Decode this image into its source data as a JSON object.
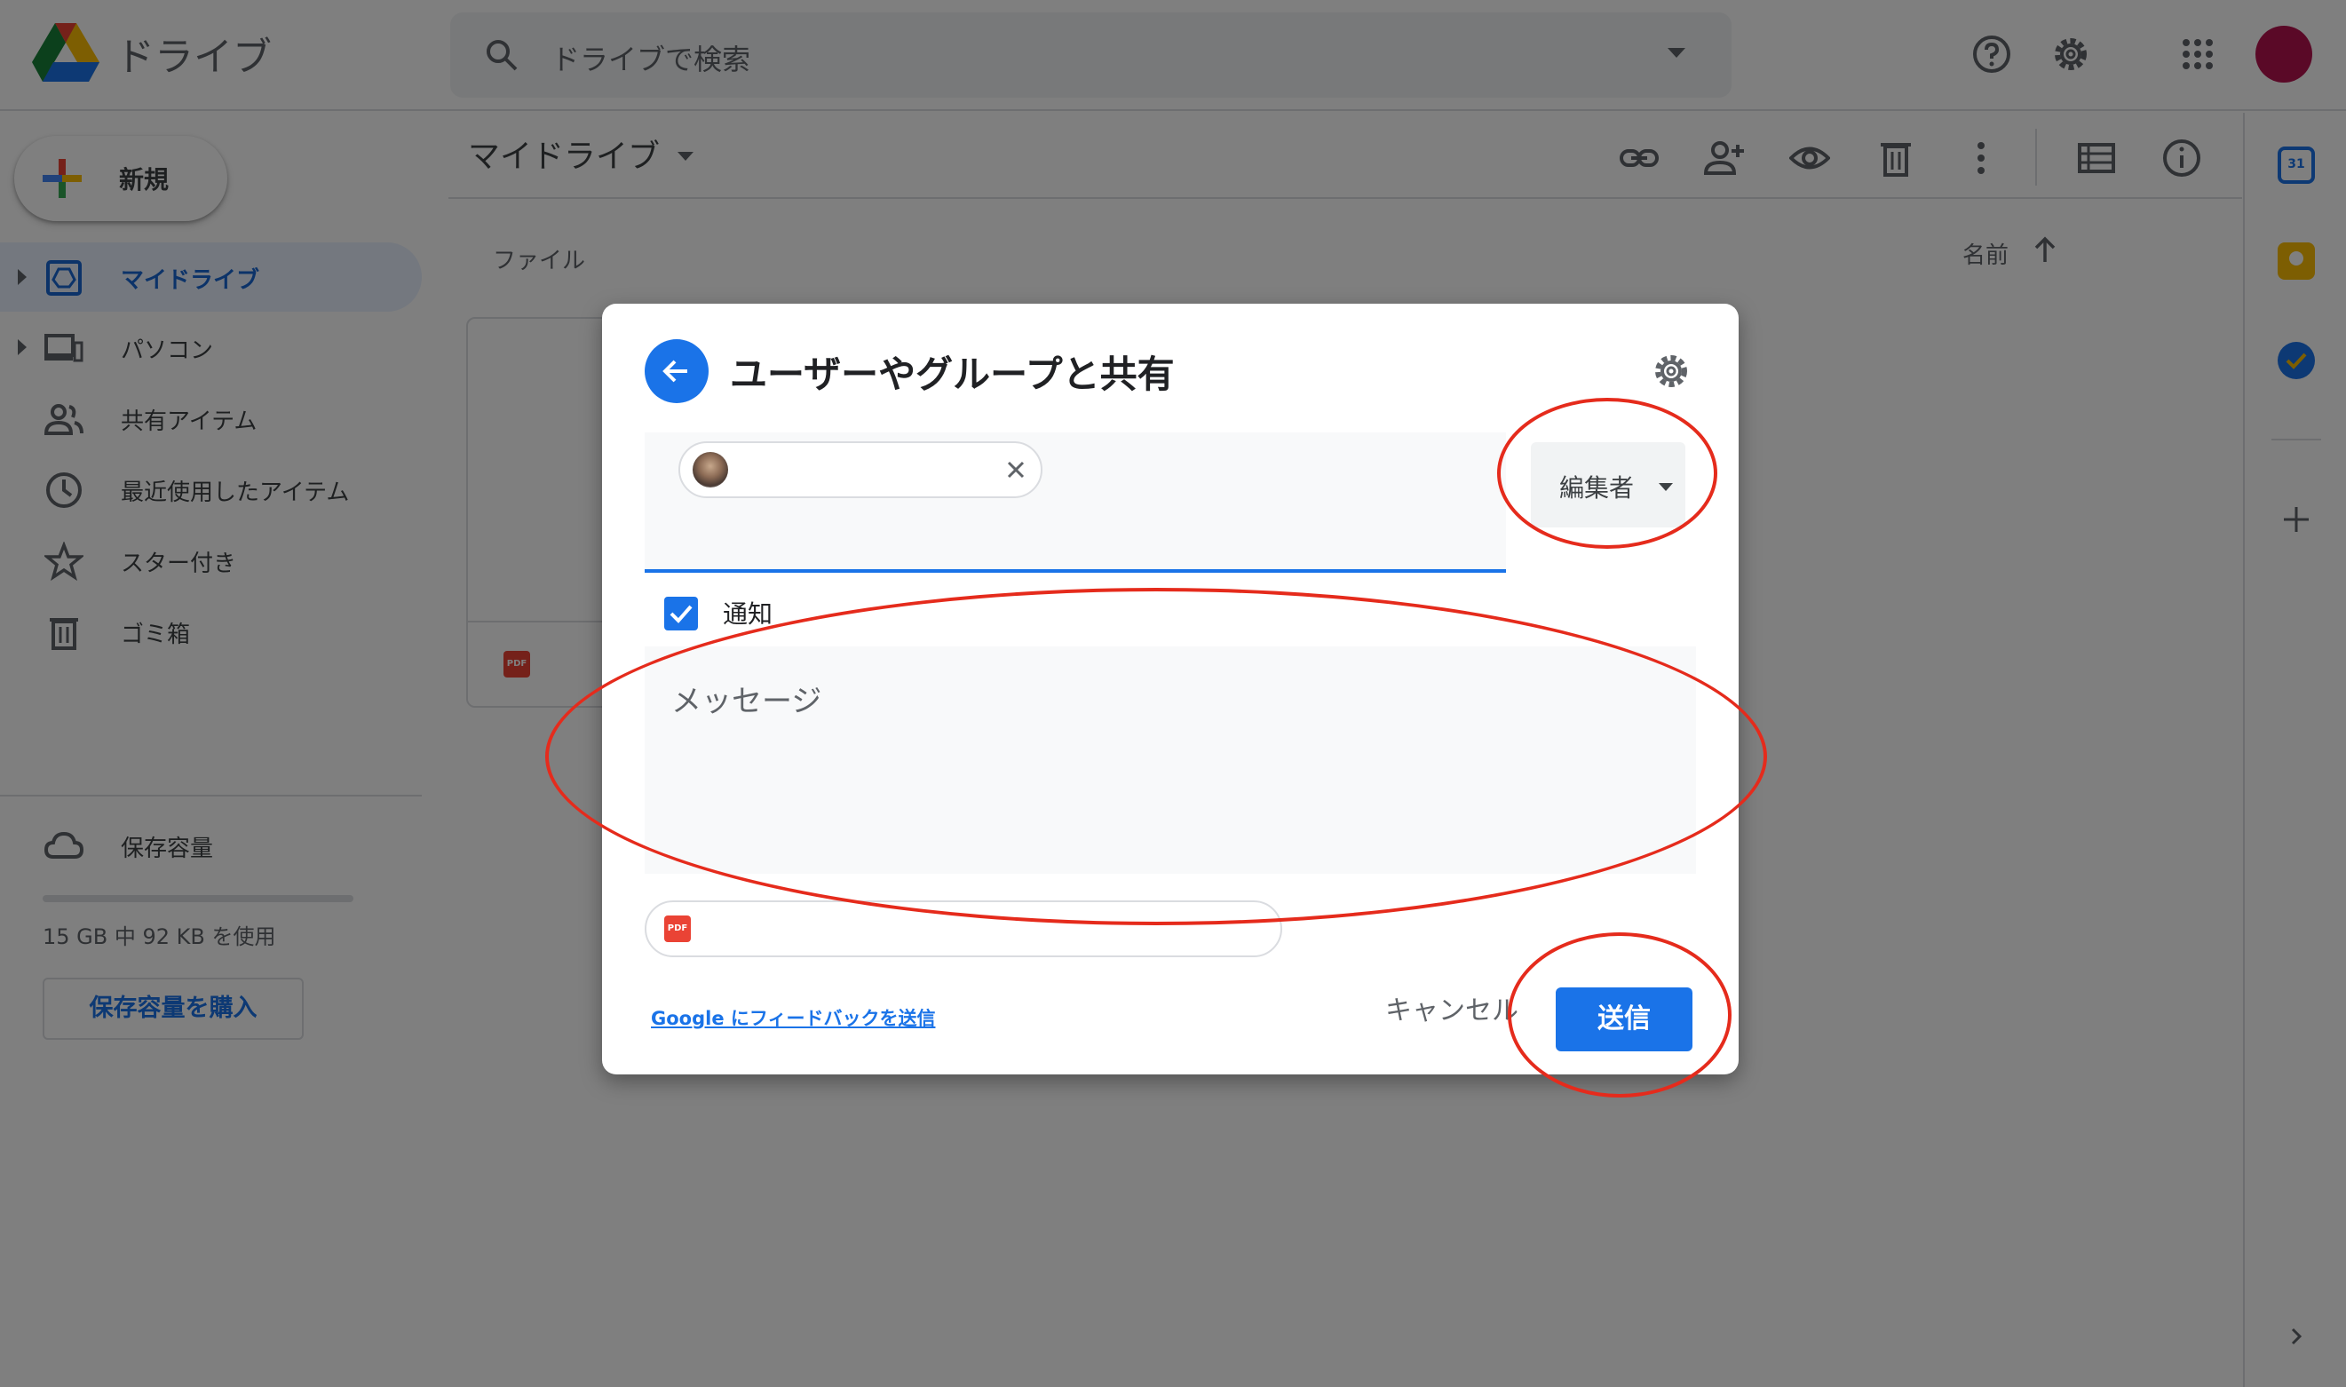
{
  "app": {
    "title": "ドライブ",
    "search_placeholder": "ドライブで検索"
  },
  "topbar": {
    "icons": [
      "help-icon",
      "settings-icon",
      "apps-grid-icon"
    ],
    "avatar_color": "#b4124e"
  },
  "sidebar": {
    "new_label": "新規",
    "items": [
      {
        "label": "マイドライブ",
        "icon": "my-drive-icon",
        "active": true
      },
      {
        "label": "パソコン",
        "icon": "computer-icon"
      },
      {
        "label": "共有アイテム",
        "icon": "shared-people-icon"
      },
      {
        "label": "最近使用したアイテム",
        "icon": "clock-icon"
      },
      {
        "label": "スター付き",
        "icon": "star-icon"
      },
      {
        "label": "ゴミ箱",
        "icon": "trash-icon"
      },
      {
        "label": "保存容量",
        "icon": "cloud-icon"
      }
    ],
    "storage_used": "15 GB 中 92 KB を使用",
    "buy_storage": "保存容量を購入"
  },
  "main": {
    "breadcrumb": "マイドライブ",
    "files_header": "ファイル",
    "sort_label": "名前",
    "toolbar_icons": [
      "link-icon",
      "add-person-icon",
      "preview-eye-icon",
      "trash-icon",
      "more-vert-icon",
      "list-view-icon",
      "info-icon"
    ],
    "file_badge": "PDF"
  },
  "dialog": {
    "title": "ユーザーやグループと共有",
    "role": "編集者",
    "notify_label": "通知",
    "notify_checked": true,
    "message_placeholder": "メッセージ",
    "attachment_badge": "PDF",
    "feedback_link": "Google にフィードバックを送信",
    "cancel_label": "キャンセル",
    "send_label": "送信"
  },
  "right_panel": {
    "icons": [
      "calendar-icon",
      "keep-icon",
      "tasks-icon",
      "add-icon"
    ],
    "calendar_day": "31"
  },
  "colors": {
    "accent": "#1a73e8",
    "annotation": "#e52b1c",
    "active_nav_bg": "#e8f0fe"
  }
}
